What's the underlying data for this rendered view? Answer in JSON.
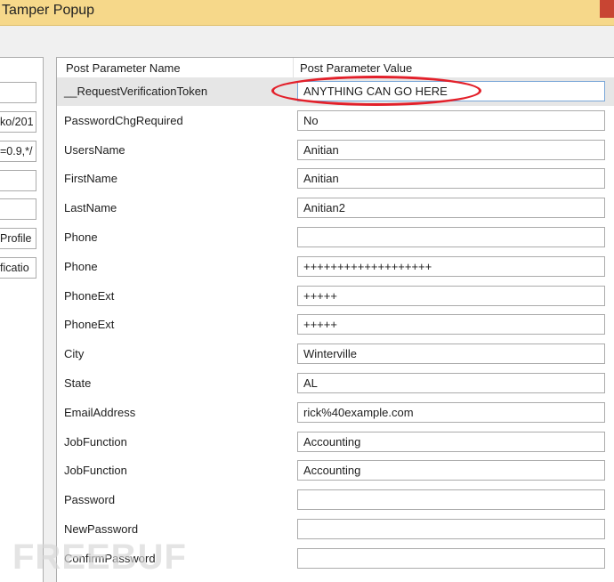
{
  "window": {
    "title": "Tamper Popup"
  },
  "left_fields": [
    "ko/201",
    "=0.9,*/",
    "Profile",
    "ficatio"
  ],
  "grid": {
    "header_name": "Post Parameter Name",
    "header_value": "Post Parameter Value",
    "rows": [
      {
        "name": "__RequestVerificationToken",
        "value": "ANYTHING CAN GO HERE",
        "selected": true
      },
      {
        "name": "PasswordChgRequired",
        "value": "No"
      },
      {
        "name": "UsersName",
        "value": "Anitian"
      },
      {
        "name": "FirstName",
        "value": "Anitian"
      },
      {
        "name": "LastName",
        "value": "Anitian2"
      },
      {
        "name": "Phone",
        "value": ""
      },
      {
        "name": "Phone",
        "value": "+++++++++++++++++++"
      },
      {
        "name": "PhoneExt",
        "value": "+++++"
      },
      {
        "name": "PhoneExt",
        "value": "+++++"
      },
      {
        "name": "City",
        "value": "Winterville"
      },
      {
        "name": "State",
        "value": "AL"
      },
      {
        "name": "EmailAddress",
        "value": "rick%40example.com"
      },
      {
        "name": "JobFunction",
        "value": "Accounting"
      },
      {
        "name": "JobFunction",
        "value": "Accounting"
      },
      {
        "name": "Password",
        "value": ""
      },
      {
        "name": "NewPassword",
        "value": ""
      },
      {
        "name": "ConfirmPassword",
        "value": ""
      }
    ]
  },
  "watermark": "FREEBUF"
}
